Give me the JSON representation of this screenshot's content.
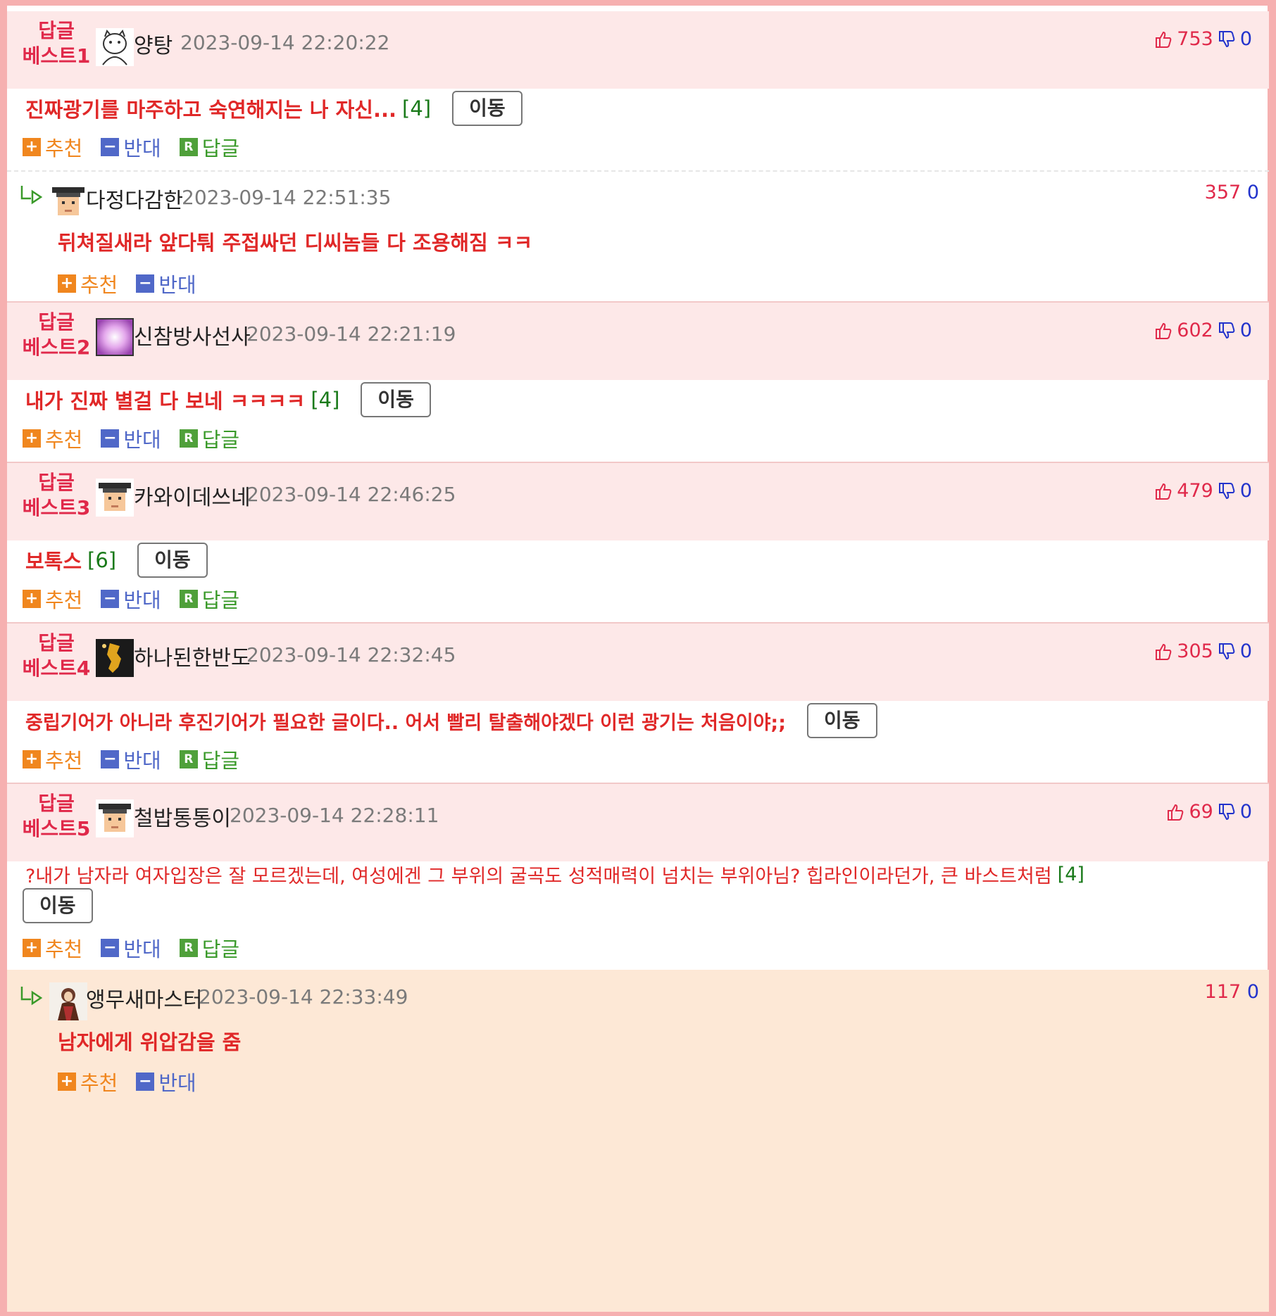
{
  "ui": {
    "move_label": "이동",
    "recommend_label": "추천",
    "oppose_label": "반대",
    "reply_label": "답글"
  },
  "colors": {
    "border": "#f6b0b0",
    "header_bg": "#fde8e8",
    "reply_bg": "#fde8d6",
    "accent_red": "#e02828"
  },
  "best": [
    {
      "label_top": "답글",
      "label_bottom": "베스트1",
      "nick": "양탕",
      "avatar_icon": "cat-avatar-icon",
      "date": "2023-09-14 22:20:22",
      "up": "753",
      "down": "0",
      "text": "진짜광기를 마주하고 숙연해지는 나 자신...",
      "count": "[4]"
    },
    {
      "label_top": "답글",
      "label_bottom": "베스트2",
      "nick": "신참방사선사",
      "avatar_icon": "purple-avatar-icon",
      "date": "2023-09-14 22:21:19",
      "up": "602",
      "down": "0",
      "text": "내가 진짜 별걸 다 보네 ㅋㅋㅋㅋ",
      "count": "[4]"
    },
    {
      "label_top": "답글",
      "label_bottom": "베스트3",
      "nick": "카와이데쓰네",
      "avatar_icon": "graduate-avatar-icon",
      "date": "2023-09-14 22:46:25",
      "up": "479",
      "down": "0",
      "text": "보톡스",
      "count": "[6]"
    },
    {
      "label_top": "답글",
      "label_bottom": "베스트4",
      "nick": "하나된한반도",
      "avatar_icon": "korea-map-avatar-icon",
      "date": "2023-09-14 22:32:45",
      "up": "305",
      "down": "0",
      "text": "중립기어가 아니라 후진기어가 필요한 글이다.. 어서 빨리 탈출해야겠다 이런 광기는 처음이야;;",
      "count": ""
    },
    {
      "label_top": "답글",
      "label_bottom": "베스트5",
      "nick": "철밥통통이",
      "avatar_icon": "graduate-avatar-icon",
      "date": "2023-09-14 22:28:11",
      "up": "69",
      "down": "0",
      "text": "?내가 남자라 여자입장은 잘 모르겠는데, 여성에겐 그 부위의 굴곡도 성적매력이 넘치는 부위아님? 힙라인이라던가, 큰 바스트처럼",
      "count": "[4]"
    }
  ],
  "replies": [
    {
      "nick": "다정다감한",
      "date": "2023-09-14 22:51:35",
      "up": "357",
      "down": "0",
      "text": "뒤쳐질새라 앞다퉈 주접싸던 디씨놈들 다 조용해짐 ㅋㅋ"
    },
    {
      "nick": "앵무새마스터",
      "date": "2023-09-14 22:33:49",
      "up": "117",
      "down": "0",
      "text": "남자에게 위압감을 줌"
    }
  ]
}
